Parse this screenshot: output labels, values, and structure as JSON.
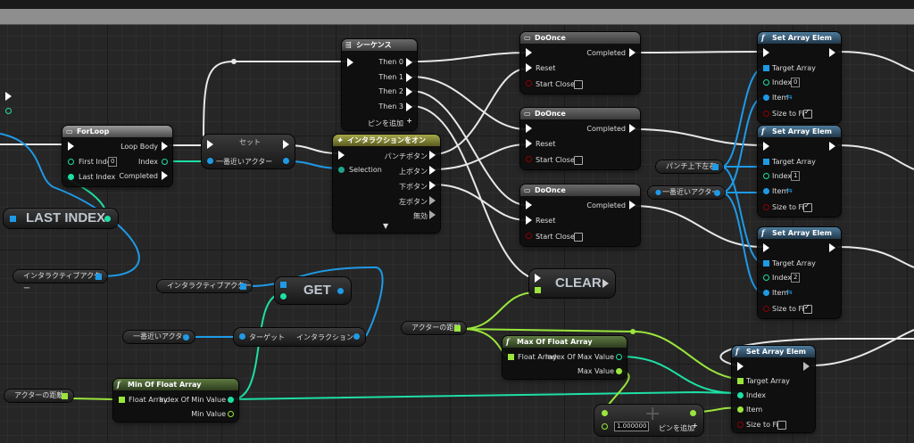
{
  "colors": {
    "exec": "#ffffff",
    "object": "#1e9ae6",
    "int": "#1edfa5",
    "float": "#9ae63c",
    "bool": "#8c0000"
  },
  "sequence": {
    "title": "シーケンス",
    "pins": [
      "Then 0",
      "Then 1",
      "Then 2",
      "Then 3"
    ],
    "add_pin": "ピンを追加"
  },
  "doonce": [
    {
      "title": "DoOnce",
      "completed": "Completed",
      "reset": "Reset",
      "start_closed": "Start Closed"
    },
    {
      "title": "DoOnce",
      "completed": "Completed",
      "reset": "Reset",
      "start_closed": "Start Closed"
    },
    {
      "title": "DoOnce",
      "completed": "Completed",
      "reset": "Reset",
      "start_closed": "Start Closed"
    }
  ],
  "set_array": [
    {
      "title": "Set Array Elem",
      "target": "Target Array",
      "index_label": "Index",
      "index": "0",
      "item": "Item",
      "size": "Size to Fit"
    },
    {
      "title": "Set Array Elem",
      "target": "Target Array",
      "index_label": "Index",
      "index": "1",
      "item": "Item",
      "size": "Size to Fit"
    },
    {
      "title": "Set Array Elem",
      "target": "Target Array",
      "index_label": "Index",
      "index": "2",
      "item": "Item",
      "size": "Size to Fit"
    },
    {
      "title": "Set Array Elem",
      "target": "Target Array",
      "index_label": "Index",
      "item": "Item",
      "size": "Size to Fit"
    }
  ],
  "forloop": {
    "title": "ForLoop",
    "loop_body": "Loop Body",
    "first_index": "First Index",
    "first_value": "0",
    "index": "Index",
    "last_index": "Last Index",
    "completed": "Completed"
  },
  "set_node": {
    "title": "セット",
    "var": "一番近いアクター"
  },
  "interaction": {
    "title": "インタラクションをオン",
    "selection": "Selection",
    "pins": [
      "パンチボタン",
      "上ボタン",
      "下ボタン",
      "左ボタン",
      "無効"
    ]
  },
  "vars": {
    "punch_dirs": "パンチ上下左右",
    "nearest_actor": "一番近いアクター",
    "nearest_actor_2": "一番近いアクター",
    "interactive_actor": "インタラクティブアクター",
    "interactive_actor_2": "インタラクティブアクター",
    "actor_dist": "アクターの距離",
    "actor_dist_2": "アクターの距離"
  },
  "macros": {
    "last_index": "LAST INDEX",
    "get": "GET",
    "clear": "CLEAR"
  },
  "interaction_call": {
    "target": "ターゲット",
    "label": "インタラクション"
  },
  "max_float": {
    "title": "Max Of Float Array",
    "float_array": "Float Array",
    "index_of_max": "Index Of Max Value",
    "max_value": "Max Value"
  },
  "min_float": {
    "title": "Min Of Float Array",
    "float_array": "Float Array",
    "index_of_min": "Index Of Min Value",
    "min_value": "Min Value"
  },
  "make_float": {
    "value": "1.000000",
    "add_pin": "ピンを追加"
  }
}
